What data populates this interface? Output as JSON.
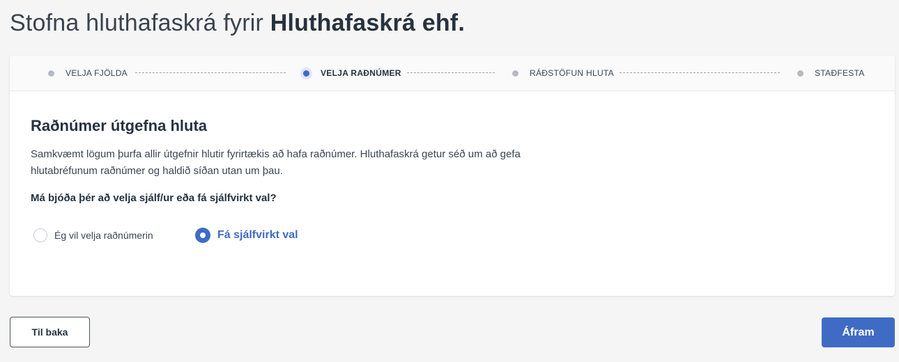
{
  "header": {
    "title_prefix": "Stofna hluthafaskrá fyrir",
    "company_name": "Hluthafaskrá ehf."
  },
  "stepper": {
    "steps": [
      {
        "label": "VELJA FJÖLDA",
        "active": false
      },
      {
        "label": "VELJA RAÐNÚMER",
        "active": true
      },
      {
        "label": "RÁÐSTÖFUN HLUTA",
        "active": false
      },
      {
        "label": "STAÐFESTA",
        "active": false
      }
    ]
  },
  "main": {
    "heading": "Raðnúmer útgefna hluta",
    "description": "Samkvæmt lögum þurfa allir útgefnir hlutir fyrirtækis að hafa raðnúmer. Hluthafaskrá getur séð um að gefa hlutabréfunum raðnúmer og haldið síðan utan um þau.",
    "question": "Má bjóða þér að velja sjálf/ur eða fá sjálfvirkt val?",
    "options": [
      {
        "label": "Ég vil velja raðnúmerin",
        "selected": false
      },
      {
        "label": "Fá sjálfvirkt val",
        "selected": true
      }
    ]
  },
  "footer": {
    "back_label": "Til baka",
    "next_label": "Áfram"
  },
  "colors": {
    "accent": "#3f6bc4",
    "background": "#f5f5f5",
    "text": "#26323f",
    "inactive_dot": "#b6bac1"
  }
}
